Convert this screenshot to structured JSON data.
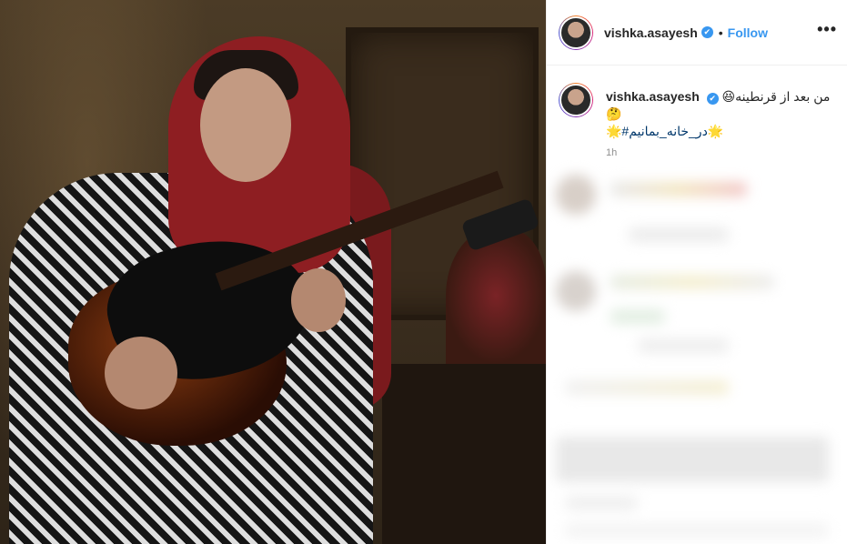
{
  "post": {
    "username": "vishka.asayesh",
    "follow_label": "Follow",
    "separator": "•",
    "more_label": "•••",
    "verified_mark": "✔"
  },
  "caption": {
    "username": "vishka.asayesh",
    "text": "من بعد از قرنطینه😆🤔",
    "hashtag": "🌟#در_خانه_بمانیم🌟",
    "time": "1h"
  },
  "icons": {
    "verified": "verified-badge-icon",
    "more": "more-options-icon"
  },
  "colors": {
    "accent_blue": "#3897f0",
    "text": "#262626",
    "muted": "#8e8e8e",
    "hashtag": "#00376b"
  }
}
